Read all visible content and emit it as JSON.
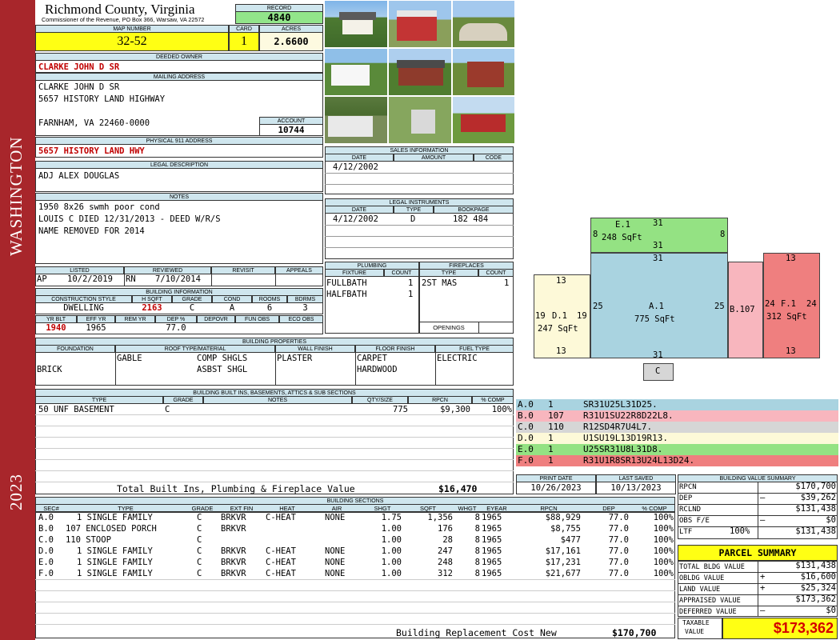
{
  "sidebar": {
    "township": "WASHINGTON",
    "year": "2023",
    "color": "#a8262b"
  },
  "header": {
    "county": "Richmond County, Virginia",
    "commissioner": "Commissioner of the Revenue, PO Box 366, Warsaw, VA 22572",
    "record_label": "RECORD",
    "record": "4840",
    "map_label": "MAP NUMBER",
    "map": "32-52",
    "card_label": "CARD",
    "card": "1",
    "acres_label": "ACRES",
    "acres": "2.6600"
  },
  "owner": {
    "deeded_label": "DEEDED OWNER",
    "deeded": "CLARKE JOHN D SR",
    "mailing_label": "MAILING ADDRESS",
    "mailing": [
      "CLARKE JOHN D SR",
      "5657 HISTORY LAND HIGHWAY",
      "",
      "FARNHAM, VA 22460-0000"
    ],
    "account_label": "ACCOUNT",
    "account": "10744",
    "physical_label": "PHYSICAL 911 ADDRESS",
    "physical": "5657 HISTORY LAND HWY",
    "legal_label": "LEGAL DESCRIPTION",
    "legal": "ADJ ALEX DOUGLAS",
    "notes_label": "NOTES",
    "notes": [
      "1950 8x26 swmh poor cond",
      "LOUIS C DIED 12/31/2013 - DEED W/R/S",
      "NAME REMOVED FOR 2014"
    ]
  },
  "visits": {
    "labels": [
      "LISTED",
      "REVIEWED",
      "REVISIT",
      "APPEALS"
    ],
    "listed_by": "AP",
    "listed": "10/2/2019",
    "reviewed_by": "RN",
    "reviewed": "7/10/2014"
  },
  "building_info": {
    "title": "BUILDING INFORMATION",
    "labels": [
      "CONSTRUCTION STYLE",
      "H SQFT",
      "GRADE",
      "COND",
      "ROOMS",
      "BDRMS"
    ],
    "values": [
      "DWELLING",
      "2163",
      "C",
      "A",
      "6",
      "3"
    ],
    "labels2": [
      "YR BLT",
      "EFF YR",
      "REM YR",
      "DEP %",
      "DEPOVR",
      "FUN OBS",
      "ECO OBS"
    ],
    "values2": [
      "1940",
      "1965",
      "",
      "77.0",
      "",
      "",
      ""
    ]
  },
  "properties": {
    "title": "BUILDING PROPERTIES",
    "labels": [
      "FOUNDATION",
      "ROOF TYPE/MATERIAL",
      "WALL FINISH",
      "FLOOR FINISH",
      "FUEL TYPE"
    ],
    "foundation": "BRICK",
    "roof_type": "GABLE",
    "roof_material": [
      "COMP SHGLS",
      "ASBST SHGL"
    ],
    "wall": "PLASTER",
    "floor": [
      "CARPET",
      "HARDWOOD"
    ],
    "fuel": "ELECTRIC"
  },
  "sales": {
    "title": "SALES INFORMATION",
    "labels": [
      "DATE",
      "AMOUNT",
      "CODE"
    ],
    "rows": [
      [
        "4/12/2002",
        "",
        ""
      ]
    ]
  },
  "legal_instruments": {
    "title": "LEGAL INSTRUMENTS",
    "labels": [
      "DATE",
      "TYPE",
      "BOOKPAGE"
    ],
    "rows": [
      [
        "4/12/2002",
        "D",
        "182 484"
      ]
    ]
  },
  "plumbing": {
    "title": "PLUMBING",
    "labels": [
      "FIXTURE",
      "COUNT"
    ],
    "rows": [
      [
        "FULLBATH",
        "1"
      ],
      [
        "HALFBATH",
        "1"
      ]
    ]
  },
  "fireplaces": {
    "title": "FIREPLACES",
    "labels": [
      "TYPE",
      "COUNT"
    ],
    "rows": [
      [
        "2ST MAS",
        "1"
      ]
    ],
    "openings_label": "OPENINGS"
  },
  "builtins": {
    "title": "BUILDING BUILT INS, BASEMENTS, ATTICS & SUB SECTIONS",
    "labels": [
      "TYPE",
      "GRADE",
      "NOTES",
      "QTY/SIZE",
      "RPCN",
      "% COMP"
    ],
    "rows": [
      [
        "50 UNF BASEMENT",
        "C",
        "",
        "775",
        "$9,300",
        "100%"
      ]
    ],
    "total_label": "Total Built Ins, Plumbing & Fireplace Value",
    "total": "$16,470"
  },
  "sections": {
    "title": "BUILDING SECTIONS",
    "labels": [
      "SEC#",
      "TYPE",
      "GRADE",
      "EXT FIN",
      "HEAT",
      "AIR",
      "SHGT",
      "SQFT",
      "WHGT",
      "EYEAR",
      "RPCN",
      "DEP",
      "% COMP"
    ],
    "rows": [
      [
        "A.0",
        "1 SINGLE FAMILY",
        "C",
        "BRKVR",
        "C-HEAT",
        "NONE",
        "1.75",
        "1,356",
        "8",
        "1965",
        "$88,929",
        "77.0",
        "100%"
      ],
      [
        "B.0",
        "107 ENCLOSED PORCH",
        "C",
        "BRKVR",
        "",
        "",
        "1.00",
        "176",
        "8",
        "1965",
        "$8,755",
        "77.0",
        "100%"
      ],
      [
        "C.0",
        "110 STOOP",
        "C",
        "",
        "",
        "",
        "1.00",
        "28",
        "8",
        "1965",
        "$477",
        "77.0",
        "100%"
      ],
      [
        "D.0",
        "1 SINGLE FAMILY",
        "C",
        "BRKVR",
        "C-HEAT",
        "NONE",
        "1.00",
        "247",
        "8",
        "1965",
        "$17,161",
        "77.0",
        "100%"
      ],
      [
        "E.0",
        "1 SINGLE FAMILY",
        "C",
        "BRKVR",
        "C-HEAT",
        "NONE",
        "1.00",
        "248",
        "8",
        "1965",
        "$17,231",
        "77.0",
        "100%"
      ],
      [
        "F.0",
        "1 SINGLE FAMILY",
        "C",
        "BRKVR",
        "C-HEAT",
        "NONE",
        "1.00",
        "312",
        "8",
        "1965",
        "$21,677",
        "77.0",
        "100%"
      ]
    ],
    "rcn_label": "Building Replacement Cost New",
    "rcn": "$170,700"
  },
  "sketch": {
    "labels": {
      "e": [
        "E.1",
        "248 SqFt"
      ],
      "a": [
        "A.1",
        "775 SqFt"
      ],
      "d": [
        "D.1",
        "247 SqFt"
      ],
      "b": "B.107",
      "f": [
        "F.1",
        "312 SqFt"
      ],
      "c": "C"
    },
    "dims": {
      "e_top": "31",
      "e_left": "8",
      "e_right": "8",
      "e_bottom": "31",
      "a_top": "31",
      "a_left": "25",
      "a_right": "25",
      "a_bottom": "31",
      "d_top": "13",
      "d_left": "19",
      "d_right": "19",
      "d_bottom": "13",
      "f_top": "13",
      "f_left": "24",
      "f_right": "24",
      "f_bottom": "13"
    },
    "colors": {
      "a": "#a9d3e0",
      "b": "#f8b6be",
      "c": "#d6d6d6",
      "d": "#fdf9d8",
      "e": "#94e283",
      "f": "#ef7f7f"
    }
  },
  "vectors": [
    {
      "id": "A.0",
      "n": "1",
      "v": "SR31U25L31D25."
    },
    {
      "id": "B.0",
      "n": "107",
      "v": "R31U1SU22R8D22L8."
    },
    {
      "id": "C.0",
      "n": "110",
      "v": "R12SD4R7U4L7."
    },
    {
      "id": "D.0",
      "n": "1",
      "v": "U1SU19L13D19R13."
    },
    {
      "id": "E.0",
      "n": "1",
      "v": "U25SR31U8L31D8."
    },
    {
      "id": "F.0",
      "n": "1",
      "v": "R31U1R8SR13U24L13D24."
    }
  ],
  "dates": {
    "print_label": "PRINT DATE",
    "print": "10/26/2023",
    "saved_label": "LAST SAVED",
    "saved": "10/13/2023"
  },
  "value_summary": {
    "title": "BUILDING VALUE SUMMARY",
    "rpcn_label": "RPCN",
    "rpcn": "$170,700",
    "dep_label": "DEP",
    "dep_sign": "–",
    "dep": "$39,262",
    "rclnd_label": "RCLND",
    "rclnd": "$131,438",
    "obs_label": "OBS F/E",
    "obs_sign": "–",
    "obs": "$0",
    "ltf_label": "LTF",
    "ltf_pct": "100%",
    "ltf": "$131,438"
  },
  "parcel": {
    "title": "PARCEL SUMMARY",
    "bldg_label": "TOTAL BLDG VALUE",
    "bldg": "$131,438",
    "obldg_label": "OBLDG VALUE",
    "obldg_sign": "+",
    "obldg": "$16,600",
    "land_label": "LAND VALUE",
    "land_sign": "+",
    "land": "$25,324",
    "appraised_label": "APPRAISED VALUE",
    "appraised": "$173,362",
    "deferred_label": "DEFERRED VALUE",
    "deferred_sign": "–",
    "deferred": "$0",
    "taxable_label": [
      "TAXABLE",
      "VALUE"
    ],
    "taxable": "$173,362"
  }
}
